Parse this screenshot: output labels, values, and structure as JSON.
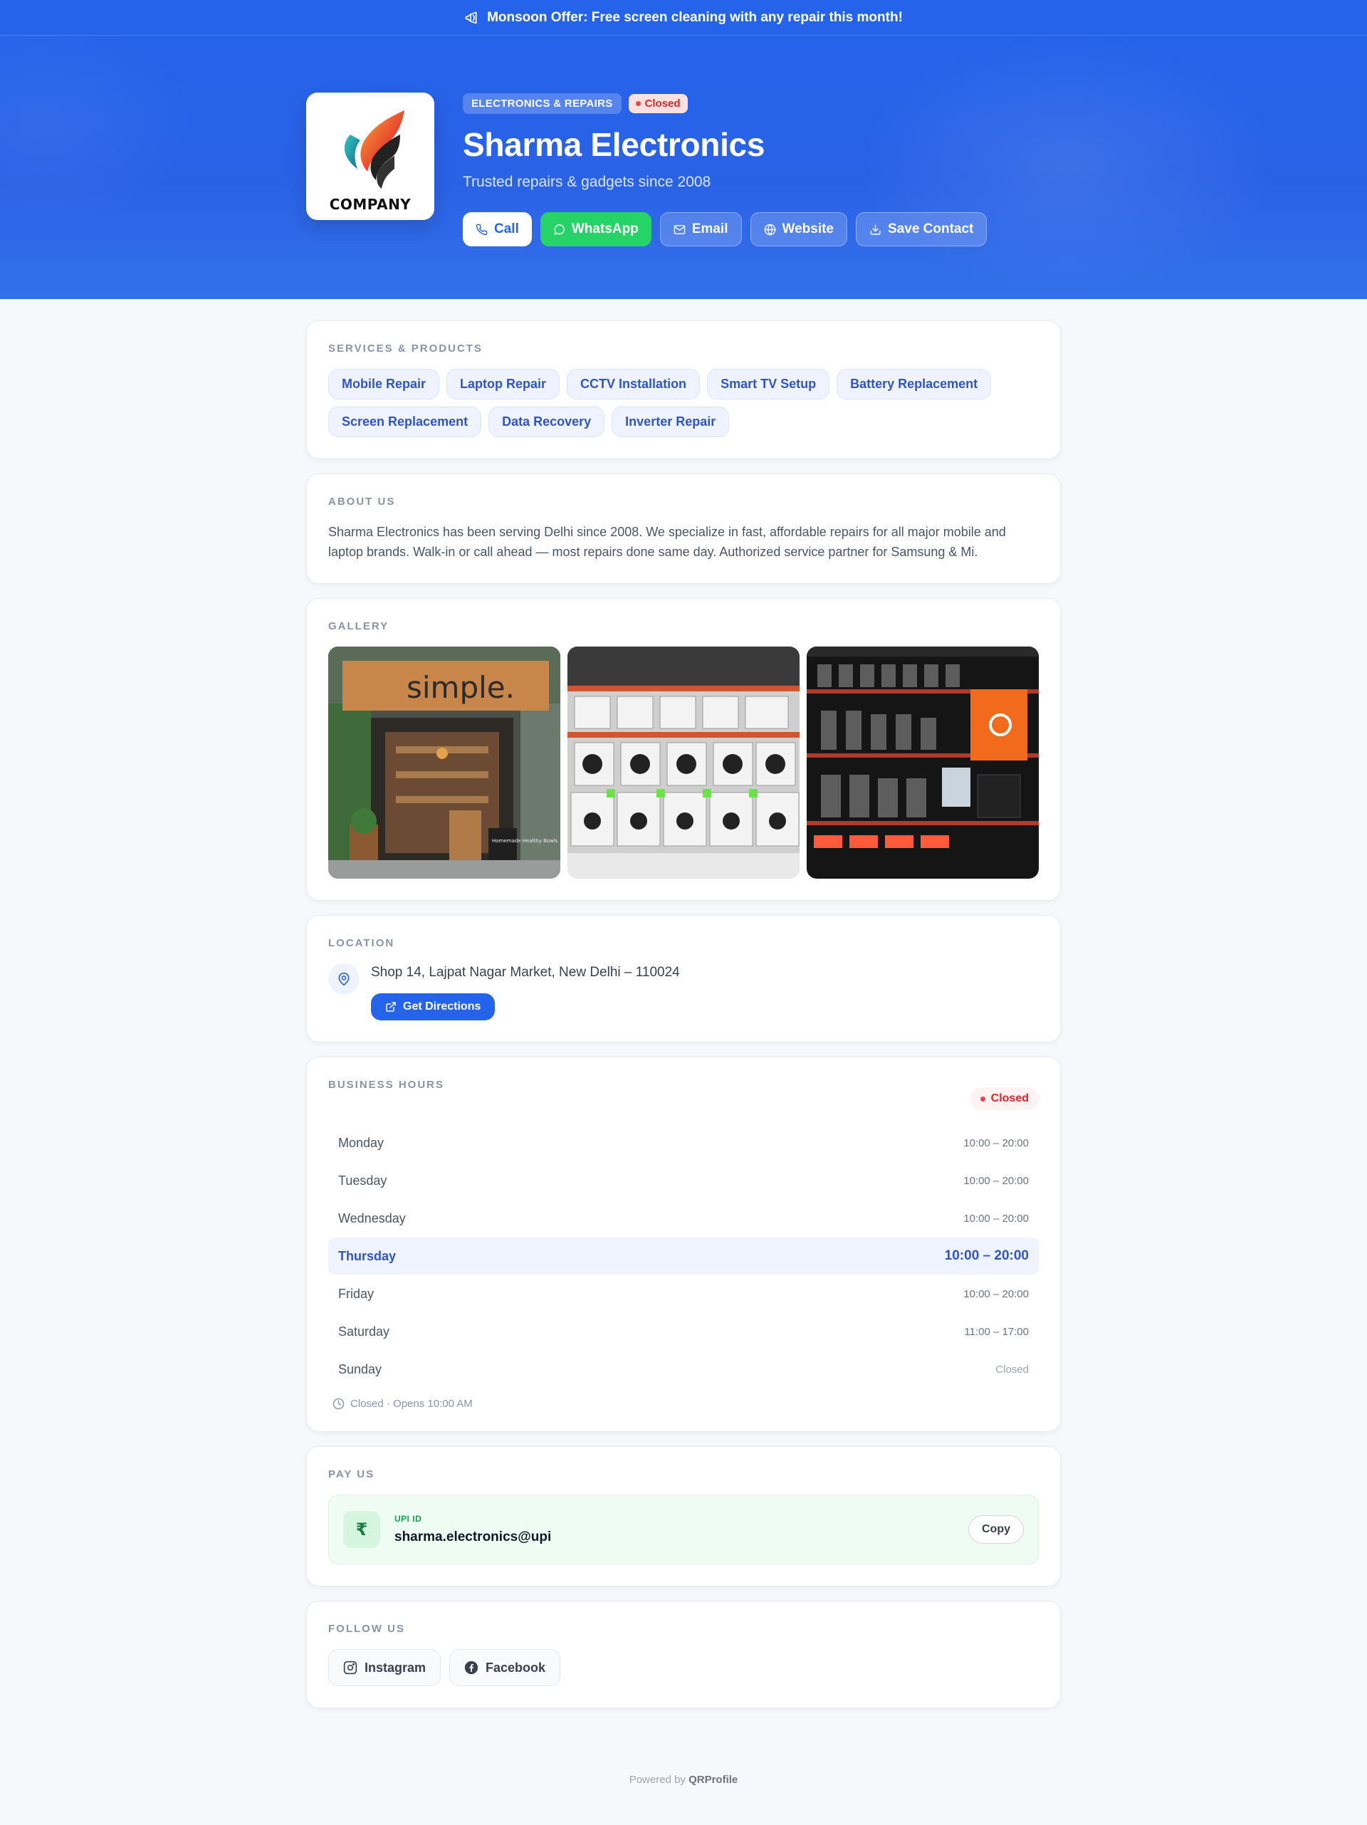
{
  "announcement": {
    "text": "Monsoon Offer: Free screen cleaning with any repair this month!",
    "icon": "megaphone-icon"
  },
  "business": {
    "logo_text": "COMPANY",
    "category": "ELECTRONICS & REPAIRS",
    "status": "Closed",
    "name": "Sharma Electronics",
    "tagline": "Trusted repairs & gadgets since 2008"
  },
  "actions": [
    {
      "label": "Call",
      "icon": "phone-icon"
    },
    {
      "label": "WhatsApp",
      "icon": "whatsapp-icon"
    },
    {
      "label": "Email",
      "icon": "mail-icon"
    },
    {
      "label": "Website",
      "icon": "globe-icon"
    },
    {
      "label": "Save Contact",
      "icon": "download-icon"
    }
  ],
  "services": {
    "title": "SERVICES & PRODUCTS",
    "items": [
      "Mobile Repair",
      "Laptop Repair",
      "CCTV Installation",
      "Smart TV Setup",
      "Battery Replacement",
      "Screen Replacement",
      "Data Recovery",
      "Inverter Repair"
    ]
  },
  "about": {
    "title": "ABOUT US",
    "text": "Sharma Electronics has been serving Delhi since 2008. We specialize in fast, affordable repairs for all major mobile and laptop brands. Walk-in or call ahead — most repairs done same day. Authorized service partner for Samsung & Mi."
  },
  "gallery": {
    "title": "GALLERY",
    "sign_text": "simple.",
    "board_text": "Homemade Healthy Bowls"
  },
  "location": {
    "title": "LOCATION",
    "address": "Shop 14, Lajpat Nagar Market, New Delhi – 110024",
    "directions_label": "Get Directions"
  },
  "hours": {
    "title": "BUSINESS HOURS",
    "status": "Closed",
    "rows": [
      {
        "day": "Monday",
        "time": "10:00 – 20:00"
      },
      {
        "day": "Tuesday",
        "time": "10:00 – 20:00"
      },
      {
        "day": "Wednesday",
        "time": "10:00 – 20:00"
      },
      {
        "day": "Thursday",
        "time": "10:00 – 20:00"
      },
      {
        "day": "Friday",
        "time": "10:00 – 20:00"
      },
      {
        "day": "Saturday",
        "time": "11:00 – 17:00"
      },
      {
        "day": "Sunday",
        "time": "Closed"
      }
    ],
    "note": "Closed · Opens 10:00 AM"
  },
  "pay": {
    "title": "PAY US",
    "symbol": "₹",
    "label": "UPI ID",
    "upi_id": "sharma.electronics@upi",
    "copy_label": "Copy"
  },
  "follow": {
    "title": "FOLLOW US",
    "items": [
      {
        "label": "Instagram",
        "icon": "instagram-icon"
      },
      {
        "label": "Facebook",
        "icon": "facebook-icon"
      }
    ]
  },
  "footer": {
    "prefix": "Powered by",
    "brand": "QRProfile"
  },
  "colors": {
    "primary": "#2563eb",
    "whatsapp": "#25d366",
    "closed": "#dc2626",
    "pay_bg": "#effcf3"
  }
}
